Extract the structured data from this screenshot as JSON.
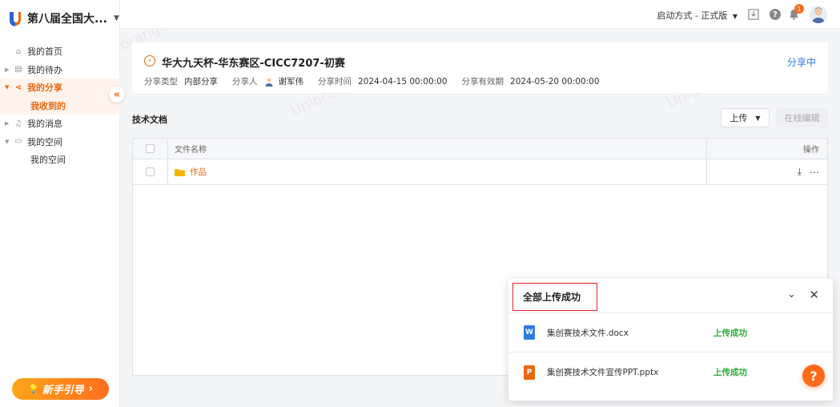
{
  "brand": {
    "name": "第八届全国大..."
  },
  "topbar": {
    "boot_mode": "启动方式 - 正式版",
    "notif_count": "1"
  },
  "sidebar": {
    "items": [
      {
        "label": "我的首页",
        "icon": "home-icon"
      },
      {
        "label": "我的待办",
        "icon": "todo-icon"
      },
      {
        "label": "我的分享",
        "icon": "share-icon"
      },
      {
        "label": "我收到的"
      },
      {
        "label": "我的消息",
        "icon": "bell-icon"
      },
      {
        "label": "我的空间",
        "icon": "archive-icon"
      },
      {
        "label": "我的空间"
      }
    ],
    "guide": "新手引导"
  },
  "share": {
    "title": "华大九天杯-华东赛区-CICC7207-初赛",
    "status": "分享中",
    "type_label": "分享类型",
    "type_value": "内部分享",
    "sharer_label": "分享人",
    "sharer_value": "谢军伟",
    "time_label": "分享时间",
    "time_value": "2024-04-15 00:00:00",
    "expire_label": "分享有效期",
    "expire_value": "2024-05-20 00:00:00"
  },
  "docs": {
    "section_title": "技术文档",
    "upload_label": "上传",
    "edit_label": "在线编辑",
    "col_name": "文件名称",
    "col_op": "操作",
    "rows": [
      {
        "name": "作品"
      }
    ]
  },
  "upload_panel": {
    "title": "全部上传成功",
    "files": [
      {
        "type": "word",
        "icon_letter": "W",
        "name": "集创赛技术文件.docx",
        "status": "上传成功"
      },
      {
        "type": "ppt",
        "icon_letter": "P",
        "name": "集创赛技术文件宣传PPT.pptx",
        "status": "上传成功"
      }
    ]
  },
  "watermark_text": "Uniorange",
  "colors": {
    "accent": "#e8690f",
    "link": "#2f7ae0",
    "success": "#2bab3a"
  }
}
